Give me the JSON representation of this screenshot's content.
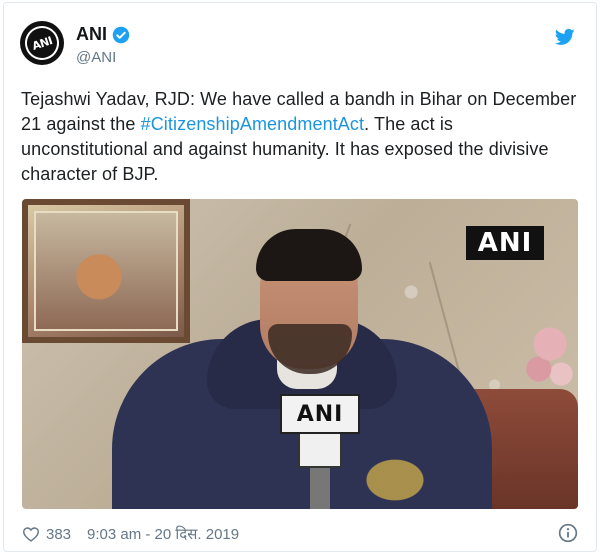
{
  "author": {
    "display_name": "ANI",
    "handle": "@ANI",
    "avatar_text": "ANI",
    "verified": true
  },
  "tweet": {
    "text_before": "Tejashwi Yadav, RJD: We have called a bandh in Bihar on December 21 against the ",
    "hashtag": "#CitizenshipAmendmentAct",
    "text_after": ". The act is unconstitutional and against humanity. It has exposed the divisive character of BJP."
  },
  "media": {
    "watermark": "ANI",
    "mic_label": "ANI"
  },
  "footer": {
    "like_count": "383",
    "timestamp": "9:03 am - 20 दिस. 2019"
  },
  "colors": {
    "link": "#1b95e0",
    "verified": "#1da1f2",
    "muted": "#657786"
  }
}
